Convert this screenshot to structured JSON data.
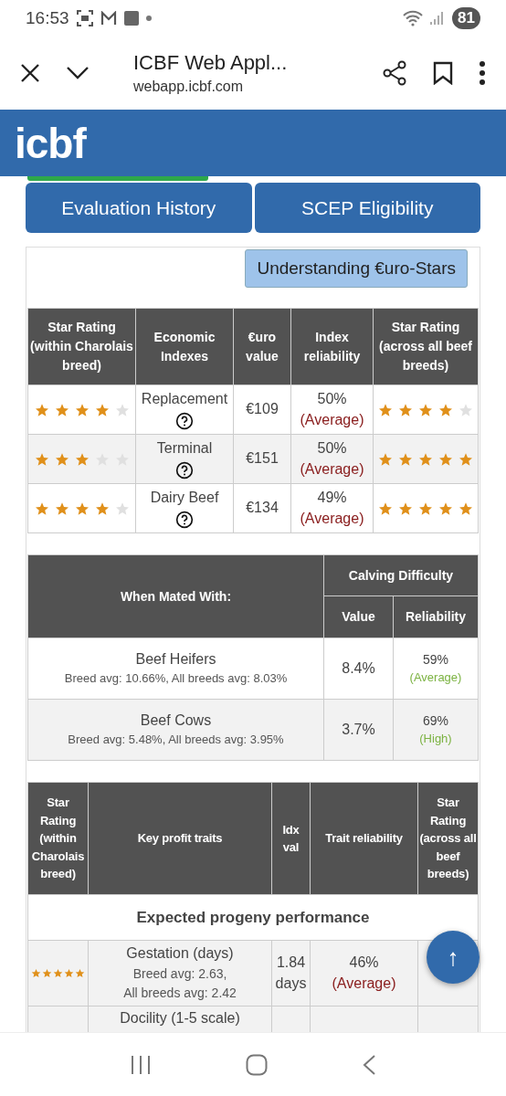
{
  "status_bar": {
    "time": "16:53",
    "battery": "81"
  },
  "browser": {
    "title": "ICBF Web Appl...",
    "url": "webapp.icbf.com"
  },
  "header": {
    "logo": "icbf"
  },
  "nav_buttons": [
    "Evaluation History",
    "SCEP Eligibility"
  ],
  "understanding_button": "Understanding €uro-Stars",
  "indexes_table": {
    "columns": [
      {
        "title": "Star Rating",
        "subtitle": "(within Charolais breed)"
      },
      {
        "title": "Economic Indexes"
      },
      {
        "title": "€uro value"
      },
      {
        "title": "Index reliability"
      },
      {
        "title": "Star Rating",
        "subtitle": "(across all beef breeds)"
      }
    ],
    "rows": [
      {
        "within": {
          "stars": 4
        },
        "index": "Replacement",
        "value": "€109",
        "reliability": "50%",
        "reliability_label": "(Average)",
        "across": {
          "stars": 4
        }
      },
      {
        "within": {
          "stars": 3
        },
        "index": "Terminal",
        "value": "€151",
        "reliability": "50%",
        "reliability_label": "(Average)",
        "across": {
          "stars": 5
        }
      },
      {
        "within": {
          "stars": 4
        },
        "index": "Dairy Beef",
        "value": "€134",
        "reliability": "49%",
        "reliability_label": "(Average)",
        "across": {
          "stars": 5
        }
      }
    ]
  },
  "calving_table": {
    "mated_header": "When Mated With:",
    "group_header": "Calving Difficulty",
    "value_header": "Value",
    "reliability_header": "Reliability",
    "rows": [
      {
        "name": "Beef Heifers",
        "averages": "Breed avg: 10.66%, All breeds avg: 8.03%",
        "value": "8.4%",
        "reliability": "59%",
        "reliability_label": "(Average)"
      },
      {
        "name": "Beef Cows",
        "averages": "Breed avg: 5.48%, All breeds avg: 3.95%",
        "value": "3.7%",
        "reliability": "69%",
        "reliability_label": "(High)"
      }
    ]
  },
  "traits_table": {
    "columns": [
      "Star Rating (within Charolais breed)",
      "Key profit traits",
      "Idx val",
      "Trait reliability",
      "Star Rating (across all beef breeds)"
    ],
    "section": "Expected progeny performance",
    "rows": [
      {
        "within": {
          "stars": 5
        },
        "trait": "Gestation (days)",
        "averages": [
          "Breed avg: 2.63,",
          "All breeds avg: 2.42"
        ],
        "value": "1.84 days",
        "reliability": "46%",
        "reliability_label": "(Average)"
      },
      {
        "trait": "Docility (1-5 scale)"
      }
    ]
  },
  "scroll_top_button": "↑"
}
